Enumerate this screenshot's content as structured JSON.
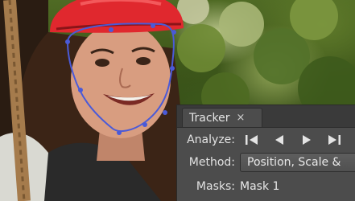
{
  "tracker": {
    "tab_label": "Tracker",
    "close_glyph": "×",
    "analyze_label": "Analyze:",
    "analyze_buttons": [
      "track-all-backward-icon",
      "track-one-backward-icon",
      "track-one-forward-icon",
      "track-all-forward-icon"
    ],
    "method_label": "Method:",
    "method_value": "Position, Scale &",
    "masks_label": "Masks:",
    "masks_value": "Mask 1"
  },
  "colors": {
    "helmet": "#e0282e",
    "mask_path": "#4a5ad8",
    "panel_bg": "#4c4c4c"
  }
}
